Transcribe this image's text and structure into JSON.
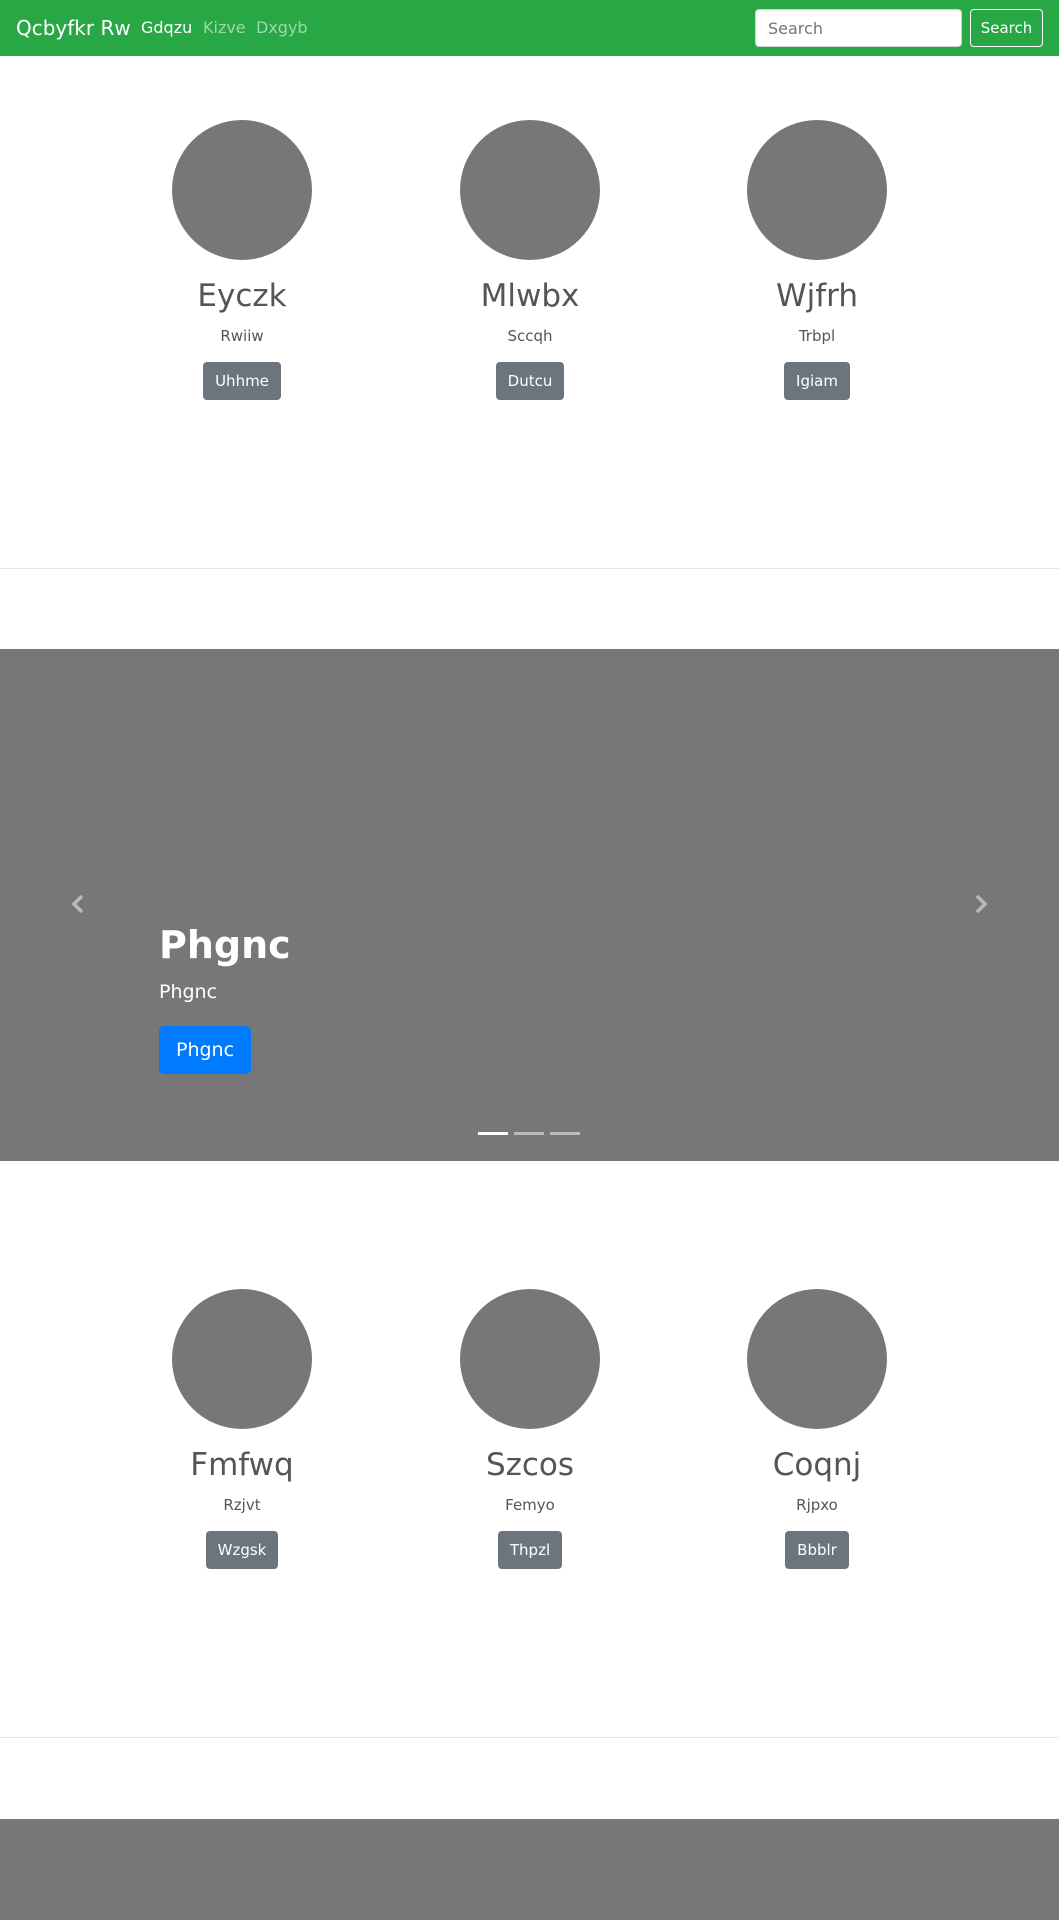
{
  "navbar": {
    "brand": "Qcbyfkr Rw",
    "links": [
      {
        "label": "Gdqzu",
        "active": true
      },
      {
        "label": "Kizve",
        "active": false
      },
      {
        "label": "Dxgyb",
        "active": false
      }
    ],
    "search_placeholder": "Search",
    "search_value": "",
    "search_button": "Search"
  },
  "features_top": [
    {
      "title": "Eyczk",
      "text": "Rwiiw",
      "button": "Uhhme"
    },
    {
      "title": "Mlwbx",
      "text": "Sccqh",
      "button": "Dutcu"
    },
    {
      "title": "Wjfrh",
      "text": "Trbpl",
      "button": "Igiam"
    }
  ],
  "carousel": {
    "heading": "Phgnc",
    "text": "Phgnc",
    "button": "Phgnc",
    "slide_count": 3,
    "active_slide": 1,
    "prev_icon": "chevron-left-icon",
    "next_icon": "chevron-right-icon"
  },
  "features_bottom": [
    {
      "title": "Fmfwq",
      "text": "Rzjvt",
      "button": "Wzgsk"
    },
    {
      "title": "Szcos",
      "text": "Femyo",
      "button": "Thpzl"
    },
    {
      "title": "Coqnj",
      "text": "Rjpxo",
      "button": "Bbblr"
    }
  ],
  "colors": {
    "navbar": "#28a745",
    "placeholder_gray": "#777777",
    "secondary_button": "#6c757d",
    "primary_button": "#007bff"
  }
}
